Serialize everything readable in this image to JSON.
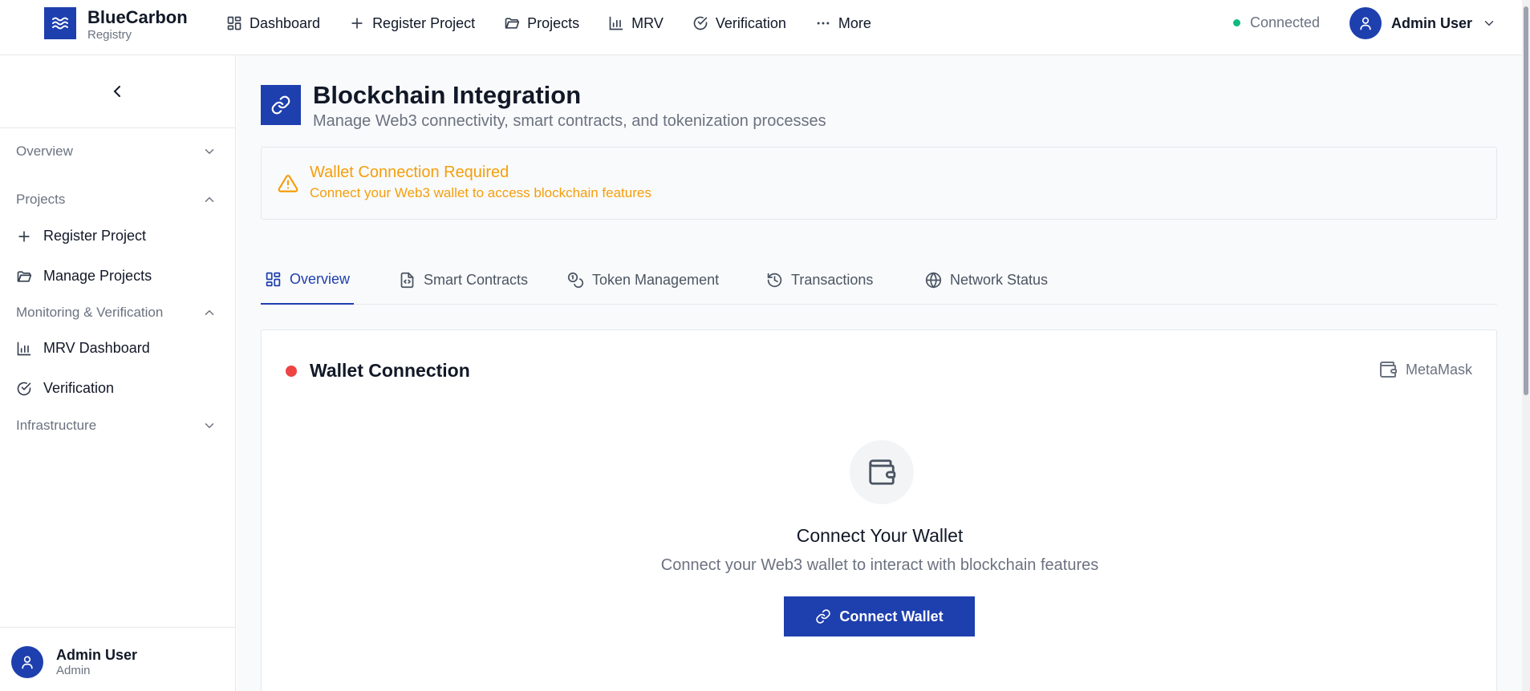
{
  "brand": {
    "name": "BlueCarbon",
    "sub": "Registry",
    "icon": "waves-icon",
    "color": "#1e3fae"
  },
  "topnav": {
    "items": [
      {
        "label": "Dashboard",
        "icon": "dashboard-icon"
      },
      {
        "label": "Register Project",
        "icon": "plus-icon"
      },
      {
        "label": "Projects",
        "icon": "folder-icon"
      },
      {
        "label": "MRV",
        "icon": "bar-chart-icon"
      },
      {
        "label": "Verification",
        "icon": "check-circle-icon"
      },
      {
        "label": "More",
        "icon": "more-icon"
      }
    ],
    "status": {
      "label": "Connected",
      "color": "#10b981"
    },
    "user": {
      "name": "Admin User"
    }
  },
  "sidebar": {
    "sections": {
      "overview": "Overview",
      "projects": "Projects",
      "monitoring": "Monitoring & Verification",
      "infrastructure": "Infrastructure"
    },
    "items": {
      "register_project": "Register Project",
      "manage_projects": "Manage Projects",
      "mrv_dashboard": "MRV Dashboard",
      "verification": "Verification"
    },
    "user": {
      "name": "Admin User",
      "role": "Admin"
    }
  },
  "page": {
    "title": "Blockchain Integration",
    "subtitle": "Manage Web3 connectivity, smart contracts, and tokenization processes"
  },
  "alert": {
    "title": "Wallet Connection Required",
    "text": "Connect your Web3 wallet to access blockchain features",
    "color": "#f59e0b"
  },
  "tabs": [
    {
      "label": "Overview",
      "active": true
    },
    {
      "label": "Smart Contracts",
      "active": false
    },
    {
      "label": "Token Management",
      "active": false
    },
    {
      "label": "Transactions",
      "active": false
    },
    {
      "label": "Network Status",
      "active": false
    }
  ],
  "wallet_card": {
    "title": "Wallet Connection",
    "status_color": "#ef4444",
    "provider": "MetaMask",
    "heading": "Connect Your Wallet",
    "description": "Connect your Web3 wallet to interact with blockchain features",
    "button_label": "Connect Wallet"
  }
}
